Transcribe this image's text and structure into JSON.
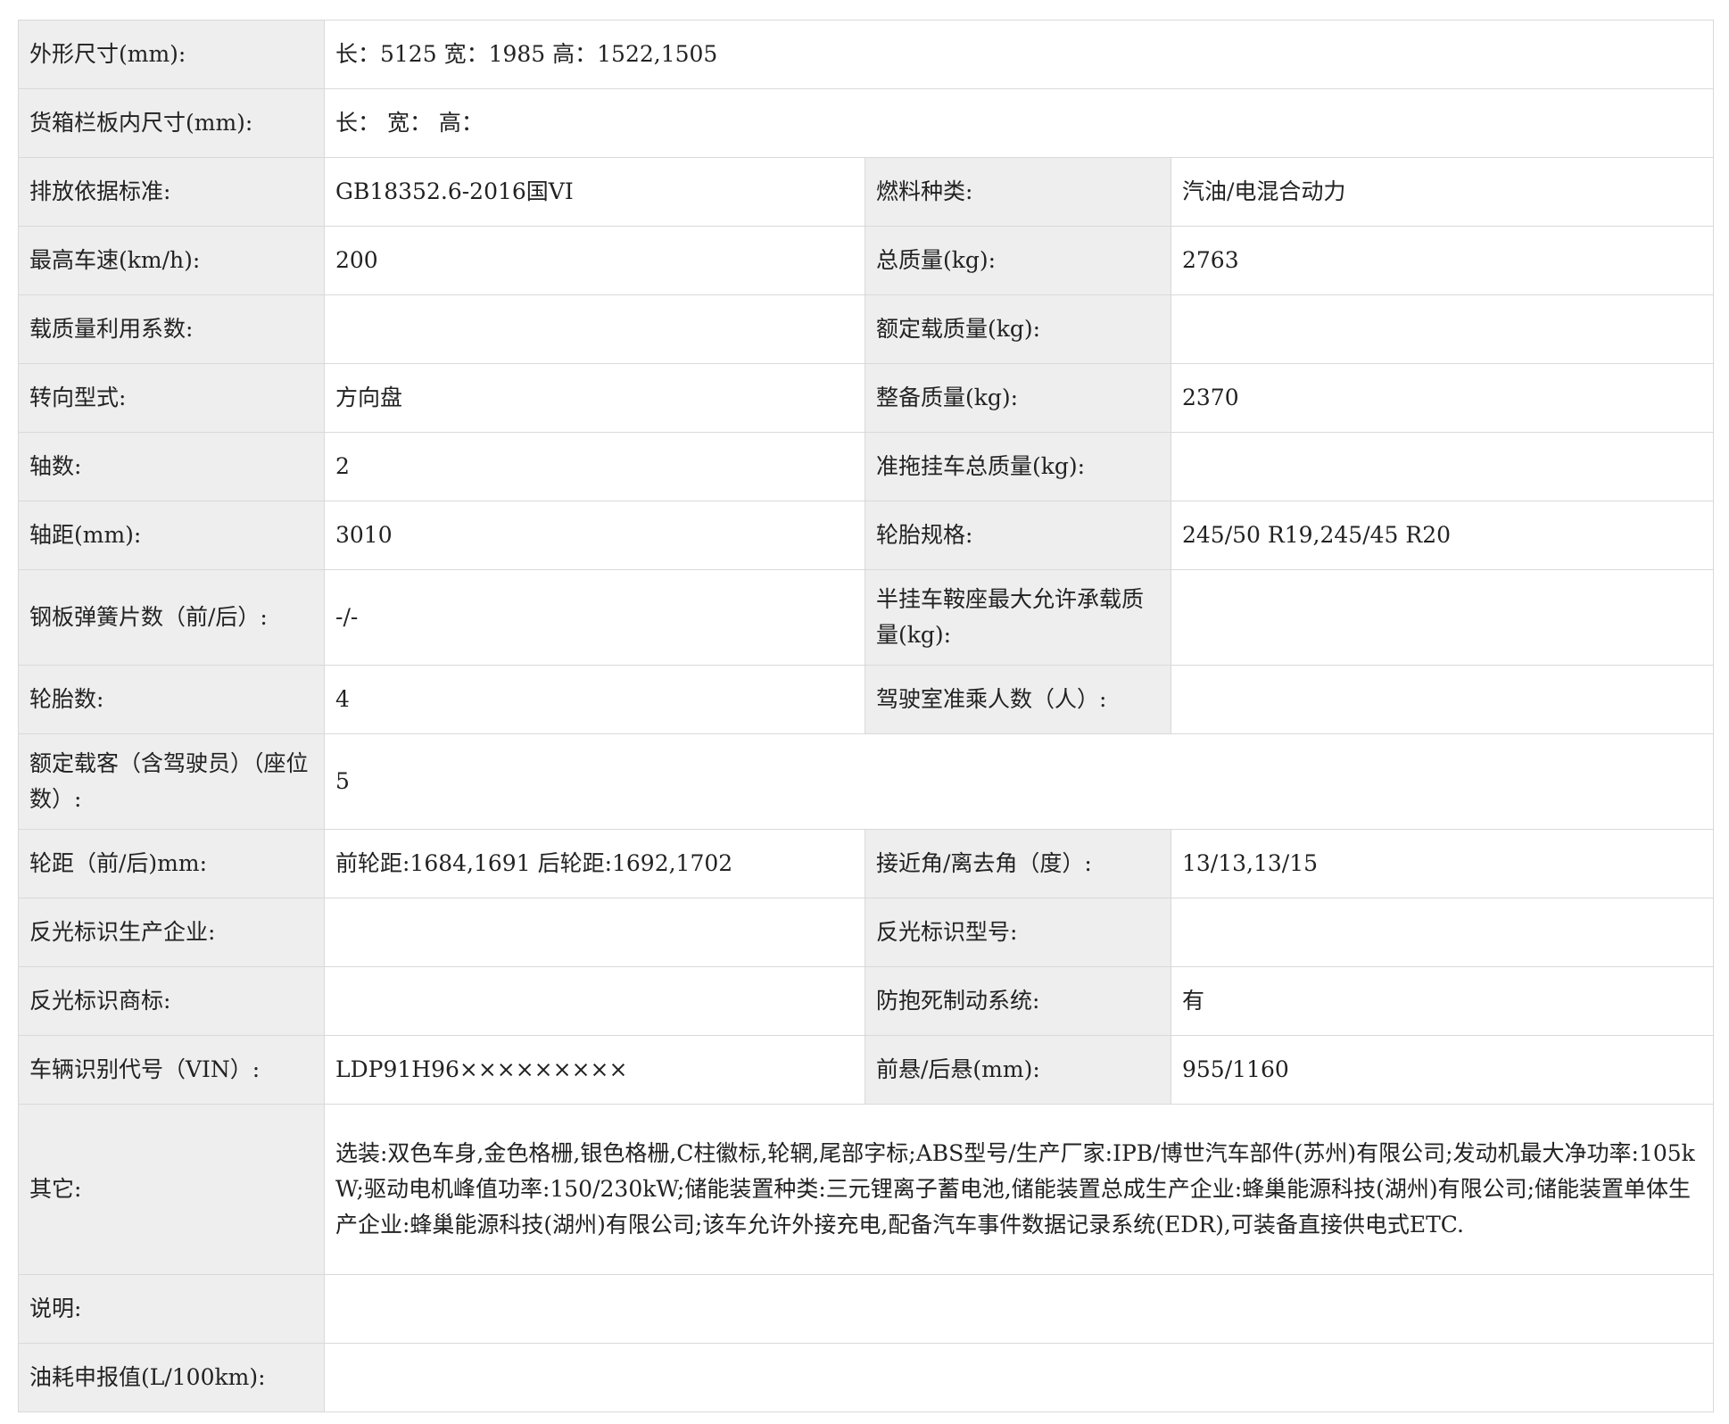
{
  "rows": [
    {
      "type": "wide",
      "label": "外形尺寸(mm):",
      "value": "长：5125 宽：1985 高：1522,1505"
    },
    {
      "type": "wide",
      "label": "货箱栏板内尺寸(mm):",
      "value": "长：  宽：  高："
    },
    {
      "type": "pair",
      "l1": "排放依据标准:",
      "v1": "GB18352.6-2016国VI",
      "l2": "燃料种类:",
      "v2": "汽油/电混合动力"
    },
    {
      "type": "pair",
      "l1": "最高车速(km/h):",
      "v1": "200",
      "l2": "总质量(kg):",
      "v2": "2763"
    },
    {
      "type": "pair",
      "l1": "载质量利用系数:",
      "v1": "",
      "l2": "额定载质量(kg):",
      "v2": ""
    },
    {
      "type": "pair",
      "l1": "转向型式:",
      "v1": "方向盘",
      "l2": "整备质量(kg):",
      "v2": "2370"
    },
    {
      "type": "pair",
      "l1": "轴数:",
      "v1": "2",
      "l2": "准拖挂车总质量(kg):",
      "v2": ""
    },
    {
      "type": "pair",
      "l1": "轴距(mm):",
      "v1": "3010",
      "l2": "轮胎规格:",
      "v2": "245/50 R19,245/45 R20"
    },
    {
      "type": "pair",
      "l1": "钢板弹簧片数（前/后）:",
      "v1": "-/-",
      "l2": "半挂车鞍座最大允许承载质量(kg):",
      "v2": ""
    },
    {
      "type": "pair",
      "l1": "轮胎数:",
      "v1": "4",
      "l2": "驾驶室准乘人数（人）:",
      "v2": ""
    },
    {
      "type": "wide",
      "label": "额定载客（含驾驶员）（座位数）:",
      "value": "5"
    },
    {
      "type": "pair",
      "l1": "轮距（前/后)mm:",
      "v1": "前轮距:1684,1691 后轮距:1692,1702",
      "l2": "接近角/离去角（度）:",
      "v2": "13/13,13/15"
    },
    {
      "type": "pair",
      "l1": "反光标识生产企业:",
      "v1": "",
      "l2": "反光标识型号:",
      "v2": ""
    },
    {
      "type": "pair",
      "l1": "反光标识商标:",
      "v1": "",
      "l2": "防抱死制动系统:",
      "v2": "有"
    },
    {
      "type": "pair",
      "l1": "车辆识别代号（VIN）:",
      "v1": "LDP91H96×××××××××",
      "l2": "前悬/后悬(mm):",
      "v2": "955/1160"
    },
    {
      "type": "wide",
      "label": "其它:",
      "value": "选装:双色车身,金色格栅,银色格栅,C柱徽标,轮辋,尾部字标;ABS型号/生产厂家:IPB/博世汽车部件(苏州)有限公司;发动机最大净功率:105kW;驱动电机峰值功率:150/230kW;储能装置种类:三元锂离子蓄电池,储能装置总成生产企业:蜂巢能源科技(湖州)有限公司;储能装置单体生产企业:蜂巢能源科技(湖州)有限公司;该车允许外接充电,配备汽车事件数据记录系统(EDR),可装备直接供电式ETC."
    },
    {
      "type": "wide",
      "label": "说明:",
      "value": ""
    },
    {
      "type": "wide",
      "label": "油耗申报值(L/100km):",
      "value": ""
    }
  ]
}
